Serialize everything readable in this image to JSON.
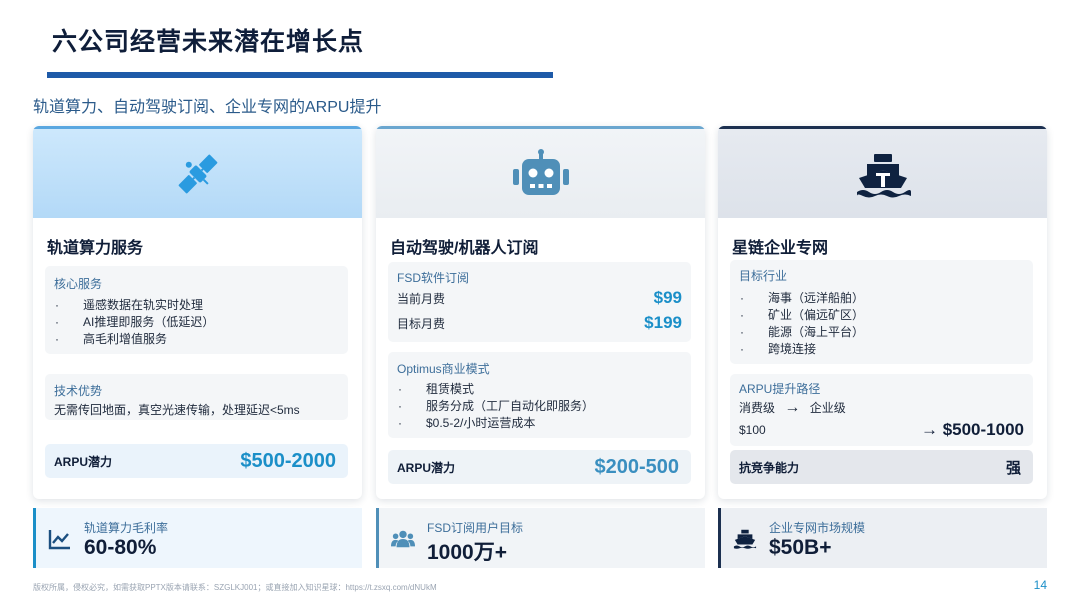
{
  "header": {
    "title": "六公司经营未来潜在增长点",
    "subtitle": "轨道算力、自动驾驶订阅、企业专网的ARPU提升"
  },
  "cards": [
    {
      "icon": "satellite-icon",
      "title": "轨道算力服务",
      "panel1": {
        "label": "核心服务",
        "bullets": [
          "遥感数据在轨实时处理",
          "AI推理即服务（低延迟）",
          "高毛利增值服务"
        ]
      },
      "panel2": {
        "label": "技术优势",
        "text": "无需传回地面，真空光速传输，处理延迟<5ms"
      },
      "arpu": {
        "label": "ARPU潜力",
        "value": "$500-2000"
      }
    },
    {
      "icon": "robot-icon",
      "title": "自动驾驶/机器人订阅",
      "panel1": {
        "label": "FSD软件订阅",
        "rows": [
          {
            "label": "当前月费",
            "value": "$99"
          },
          {
            "label": "目标月费",
            "value": "$199"
          }
        ]
      },
      "panel2": {
        "label": "Optimus商业模式",
        "bullets": [
          "租赁模式",
          "服务分成（工厂自动化即服务）",
          "$0.5-2/小时运营成本"
        ]
      },
      "arpu": {
        "label": "ARPU潜力",
        "value": "$200-500"
      }
    },
    {
      "icon": "ship-icon",
      "title": "星链企业专网",
      "panel1": {
        "label": "目标行业",
        "bullets": [
          "海事（远洋船舶）",
          "矿业（偏远矿区）",
          "能源（海上平台）",
          "跨境连接"
        ]
      },
      "panel2": {
        "label": "ARPU提升路径",
        "path_from": "消费级",
        "path_to": "企业级",
        "arrow": "→",
        "price_from": "$100",
        "price_to": "→ $500-1000"
      },
      "competitiveness": {
        "label": "抗竞争能力",
        "value": "强"
      }
    }
  ],
  "stats": [
    {
      "icon": "chart-line-icon",
      "label": "轨道算力毛利率",
      "value": "60-80%"
    },
    {
      "icon": "users-icon",
      "label": "FSD订阅用户目标",
      "value": "1000万+"
    },
    {
      "icon": "ship-icon",
      "label": "企业专网市场规模",
      "value": "$50B+"
    }
  ],
  "footer": {
    "text": "版权所属，侵权必究，如需获取PPTX版本请联系：SZGLKJ001；或直接加入知识星球：https://t.zsxq.com/dNUkM",
    "page_number": "14"
  },
  "colors": {
    "accent": "#1b8fc8",
    "title_bar": "#1e5aa8",
    "hero1_bg": "#bfe0fa",
    "hero2_bg": "#eef1f4",
    "hero3_bg": "#e3e7ee"
  }
}
